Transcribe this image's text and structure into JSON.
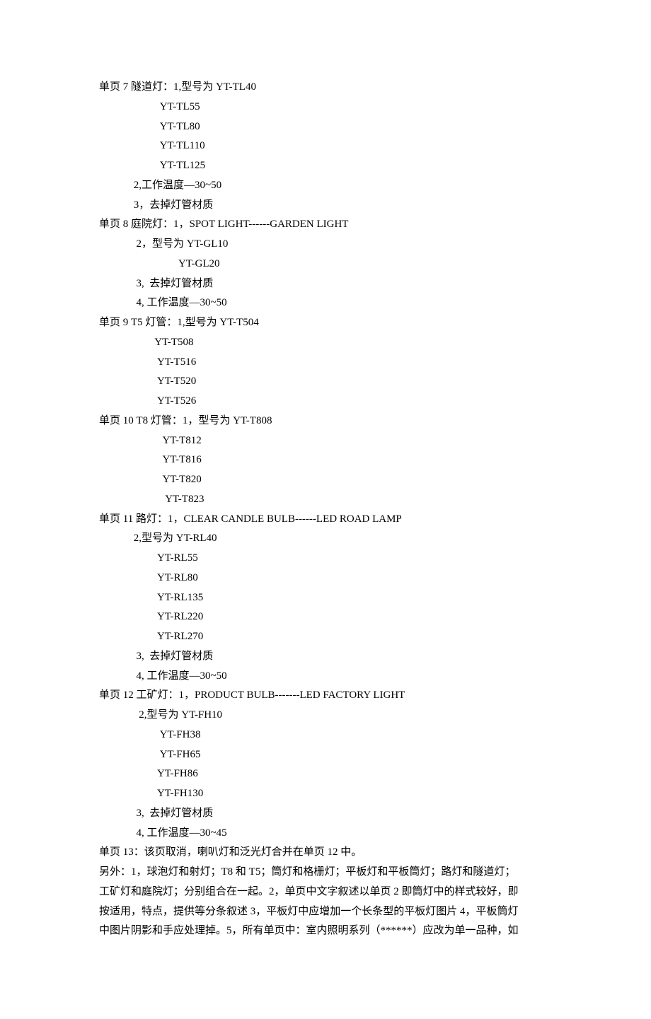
{
  "lines": [
    "单页 7 隧道灯：1,型号为 YT-TL40",
    "                       YT-TL55",
    "                       YT-TL80",
    "                       YT-TL110",
    "                       YT-TL125",
    "             2,工作温度—30~50",
    "             3，去掉灯管材质",
    "单页 8 庭院灯：1，SPOT LIGHT------GARDEN LIGHT",
    "              2，型号为 YT-GL10",
    "                              YT-GL20",
    "              3,  去掉灯管材质",
    "              4, 工作温度—30~50",
    "单页 9 T5 灯管：1,型号为 YT-T504",
    "                     YT-T508",
    "                      YT-T516",
    "                      YT-T520",
    "                      YT-T526",
    "单页 10 T8 灯管：1，型号为 YT-T808",
    "                        YT-T812",
    "                        YT-T816",
    "                        YT-T820",
    "                         YT-T823",
    "单页 11 路灯：1，CLEAR CANDLE BULB------LED ROAD LAMP",
    "             2,型号为 YT-RL40",
    "                      YT-RL55",
    "                      YT-RL80",
    "                      YT-RL135",
    "                      YT-RL220",
    "                      YT-RL270",
    "              3,  去掉灯管材质",
    "              4, 工作温度—30~50",
    "单页 12 工矿灯：1，PRODUCT BULB-------LED FACTORY LIGHT",
    "               2,型号为 YT-FH10",
    "                       YT-FH38",
    "                       YT-FH65",
    "                      YT-FH86",
    "                      YT-FH130",
    "              3,  去掉灯管材质",
    "              4, 工作温度—30~45",
    "单页 13：该页取消，喇叭灯和泛光灯合并在单页 12 中。",
    "另外：1，球泡灯和射灯；T8 和 T5；筒灯和格栅灯；平板灯和平板筒灯；路灯和隧道灯；",
    "工矿灯和庭院灯；分别组合在一起。2，单页中文字叙述以单页 2 即筒灯中的样式较好，即",
    "按适用，特点，提供等分条叙述 3，平板灯中应增加一个长条型的平板灯图片 4，平板筒灯",
    "中图片阴影和手应处理掉。5，所有单页中：室内照明系列（******）应改为单一品种，如"
  ]
}
